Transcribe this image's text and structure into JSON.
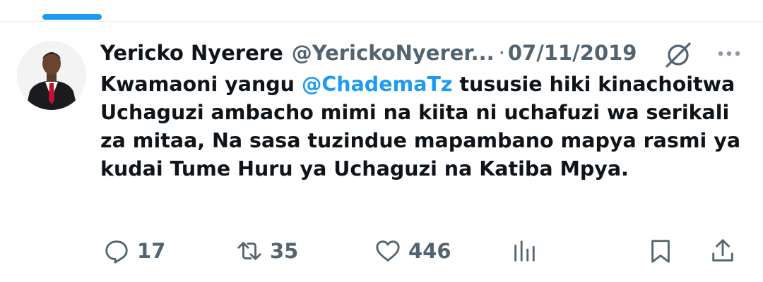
{
  "tweet": {
    "author_name": "Yericko Nyerere",
    "author_handle": "@YerickoNyerer...",
    "separator": "·",
    "date": "07/11/2019",
    "text_part1": "Kwamaoni yangu ",
    "mention": "@ChademaTz",
    "text_part2": "  tususie hiki kinachoitwa Uchaguzi ambacho mimi na kiita ni uchafuzi wa serikali za mitaa, Na sasa tuzindue mapambano mapya rasmi ya kudai Tume Huru ya Uchaguzi na Katiba Mpya."
  },
  "actions": {
    "reply_count": "17",
    "retweet_count": "35",
    "like_count": "446"
  },
  "icons": {
    "header": [
      "grok-icon",
      "more-icon"
    ],
    "actions": [
      "reply-icon",
      "retweet-icon",
      "like-icon",
      "views-icon",
      "bookmark-icon",
      "share-icon"
    ]
  },
  "colors": {
    "accent": "#1d9bf0",
    "text": "#0f1419",
    "muted": "#536471"
  }
}
